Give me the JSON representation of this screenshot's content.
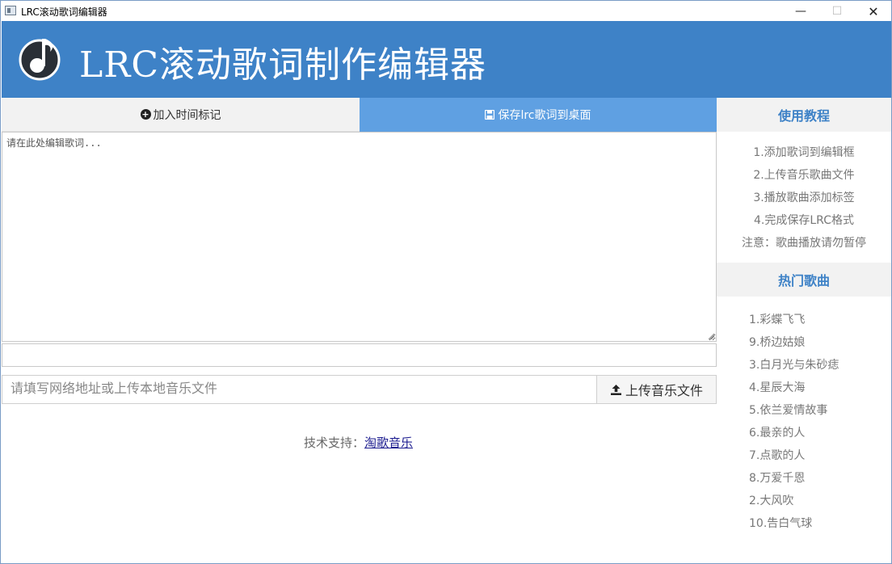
{
  "window": {
    "title": "LRC滚动歌词编辑器",
    "minimize_glyph": "—",
    "maximize_glyph": "☐",
    "close_glyph": "✕"
  },
  "header": {
    "title": "LRC滚动歌词制作编辑器",
    "logo_icon": "music-note-icon"
  },
  "toolbar": {
    "add_time_label": "加入时间标记",
    "add_time_icon": "plus-circle-icon",
    "save_label": "保存lrc歌词到桌面",
    "save_icon": "floppy-disk-icon"
  },
  "editor": {
    "placeholder": "请在此处编辑歌词..."
  },
  "music": {
    "url_placeholder": "请填写网络地址或上传本地音乐文件",
    "upload_label": "上传音乐文件",
    "upload_icon": "upload-icon"
  },
  "footer": {
    "support_prefix": "技术支持：",
    "support_link": "淘歌音乐"
  },
  "sidebar": {
    "tutorial_title": "使用教程",
    "tutorial_steps": [
      "1.添加歌词到编辑框",
      "2.上传音乐歌曲文件",
      "3.播放歌曲添加标签",
      "4.完成保存LRC格式",
      "注意：歌曲播放请勿暂停"
    ],
    "hot_title": "热门歌曲",
    "hot_songs": [
      "1.彩蝶飞飞",
      "9.桥边姑娘",
      "3.白月光与朱砂痣",
      "4.星辰大海",
      "5.依兰爱情故事",
      "6.最亲的人",
      "7.点歌的人",
      "8.万爱千恩",
      "2.大风吹",
      "10.告白气球"
    ]
  },
  "colors": {
    "brand_blue": "#3e82c7",
    "button_blue": "#5fa0e2",
    "light_gray": "#f2f2f2"
  }
}
